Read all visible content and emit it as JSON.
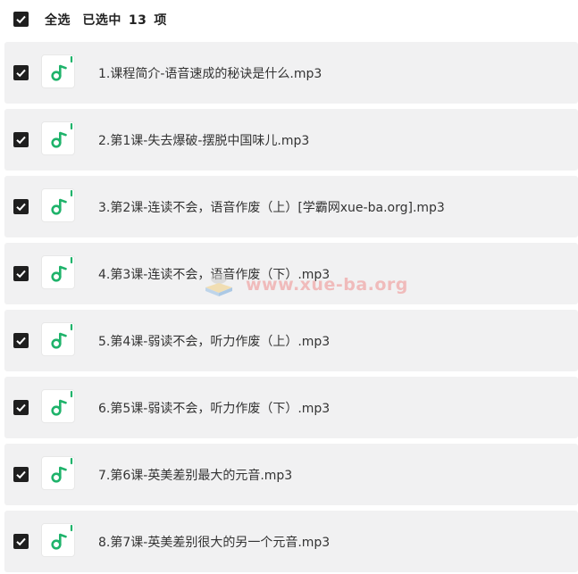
{
  "header": {
    "select_all_label": "全选",
    "selected_prefix": "已选中",
    "selected_count": "13",
    "selected_suffix": "项"
  },
  "files": [
    {
      "name": "1.课程简介-语音速成的秘诀是什么.mp3",
      "checked": true
    },
    {
      "name": "2.第1课-失去爆破-摆脱中国味儿.mp3",
      "checked": true
    },
    {
      "name": "3.第2课-连读不会，语音作废（上）[学霸网xue-ba.org].mp3",
      "checked": true
    },
    {
      "name": "4.第3课-连读不会，语音作废（下）.mp3",
      "checked": true
    },
    {
      "name": "5.第4课-弱读不会，听力作废（上）.mp3",
      "checked": true
    },
    {
      "name": "6.第5课-弱读不会，听力作废（下）.mp3",
      "checked": true
    },
    {
      "name": "7.第6课-英美差别最大的元音.mp3",
      "checked": true
    },
    {
      "name": "8.第7课-英美差别很大的另一个元音.mp3",
      "checked": true
    }
  ],
  "watermark": {
    "text": "www.xue-ba.org"
  },
  "colors": {
    "row_bg": "#f1f1f2",
    "checkbox": "#1f1f1f",
    "icon_green": "#1fb36b",
    "watermark": "#f0a9a9"
  },
  "icons": {
    "file_type": "audio-note-icon",
    "checkbox": "checkmark-icon"
  }
}
